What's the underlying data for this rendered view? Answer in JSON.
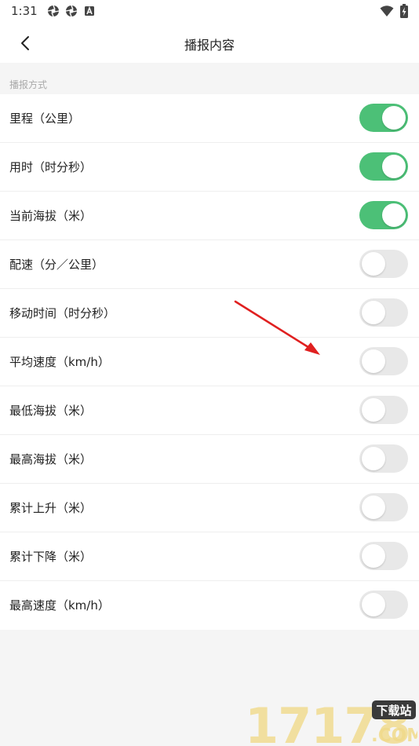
{
  "status_bar": {
    "time": "1:31"
  },
  "header": {
    "title": "播报内容"
  },
  "section": {
    "label": "播报方式"
  },
  "items": [
    {
      "label": "里程（公里）",
      "on": true
    },
    {
      "label": "用时（时分秒）",
      "on": true
    },
    {
      "label": "当前海拔（米）",
      "on": true
    },
    {
      "label": "配速（分／公里）",
      "on": false
    },
    {
      "label": "移动时间（时分秒）",
      "on": false
    },
    {
      "label": "平均速度（km/h）",
      "on": false
    },
    {
      "label": "最低海拔（米）",
      "on": false
    },
    {
      "label": "最高海拔（米）",
      "on": false
    },
    {
      "label": "累计上升（米）",
      "on": false
    },
    {
      "label": "累计下降（米）",
      "on": false
    },
    {
      "label": "最高速度（km/h）",
      "on": false
    }
  ],
  "colors": {
    "toggle_on": "#4cc077",
    "toggle_off": "#e8e8e8",
    "annotation_arrow": "#e02020"
  },
  "watermark": {
    "digits": "17178",
    "badge": "下载站",
    "domain": ".COM"
  }
}
